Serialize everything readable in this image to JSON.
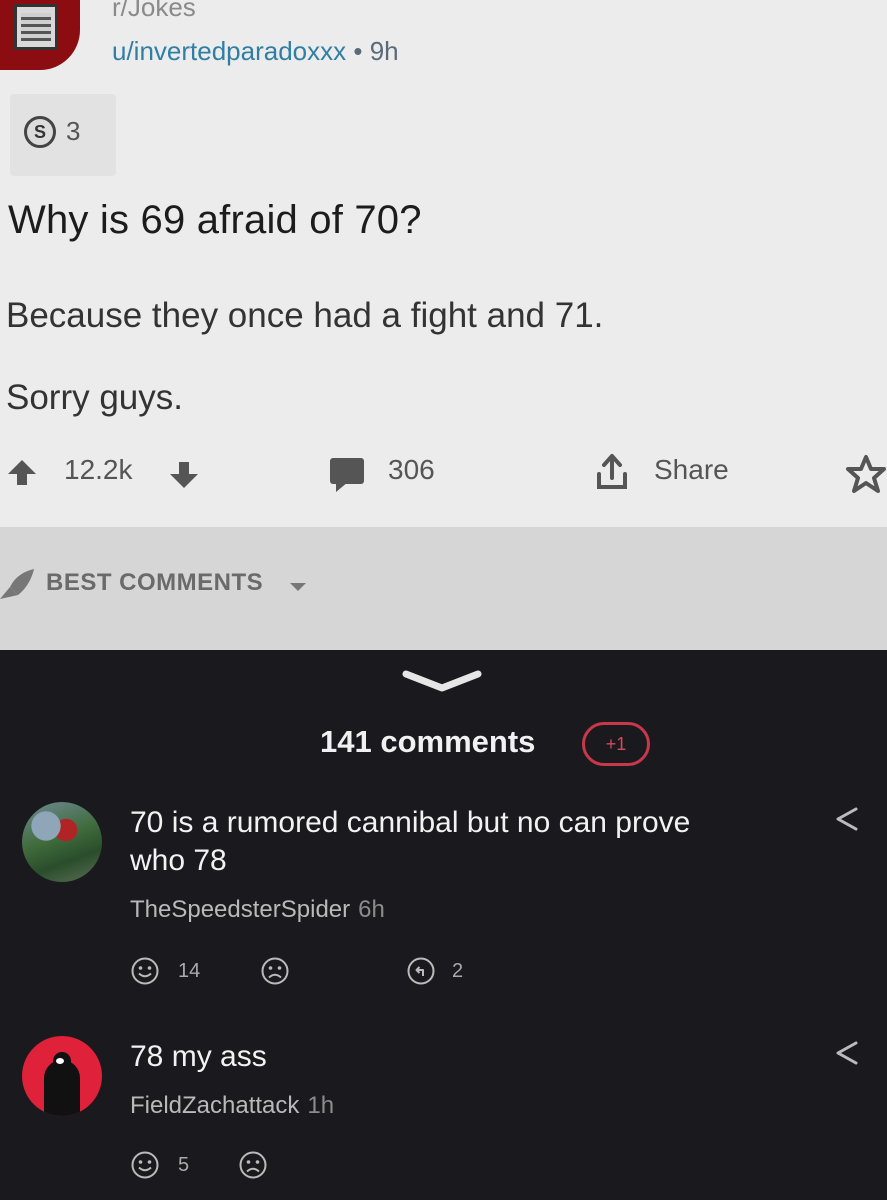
{
  "post": {
    "subreddit": "r/Jokes",
    "author": "u/invertedparadoxxx",
    "separator": "•",
    "age": "9h",
    "award_count": "3",
    "award_icon": "silver-award-icon",
    "title": "Why is 69 afraid of 70?",
    "body": [
      "Because they once had a fight and 71.",
      "Sorry guys."
    ],
    "score": "12.2k",
    "comment_count": "306",
    "share_label": "Share"
  },
  "sort": {
    "label": "BEST COMMENTS"
  },
  "comments_section": {
    "header": "141 comments",
    "new_badge": "+1"
  },
  "comments": [
    {
      "text_lines": [
        "70 is a rumored cannibal but no can prove",
        "who 78"
      ],
      "author": "TheSpeedsterSpider",
      "age": "6h",
      "likes": "14",
      "replies": "2"
    },
    {
      "text_lines": [
        "78 my ass"
      ],
      "author": "FieldZachattack",
      "age": "1h",
      "likes": "5"
    }
  ],
  "colors": {
    "light_bg": "#ececec",
    "dark_bg": "#1a1a1e",
    "author_link": "#2f7fa5",
    "badge_red": "#c8384a"
  }
}
